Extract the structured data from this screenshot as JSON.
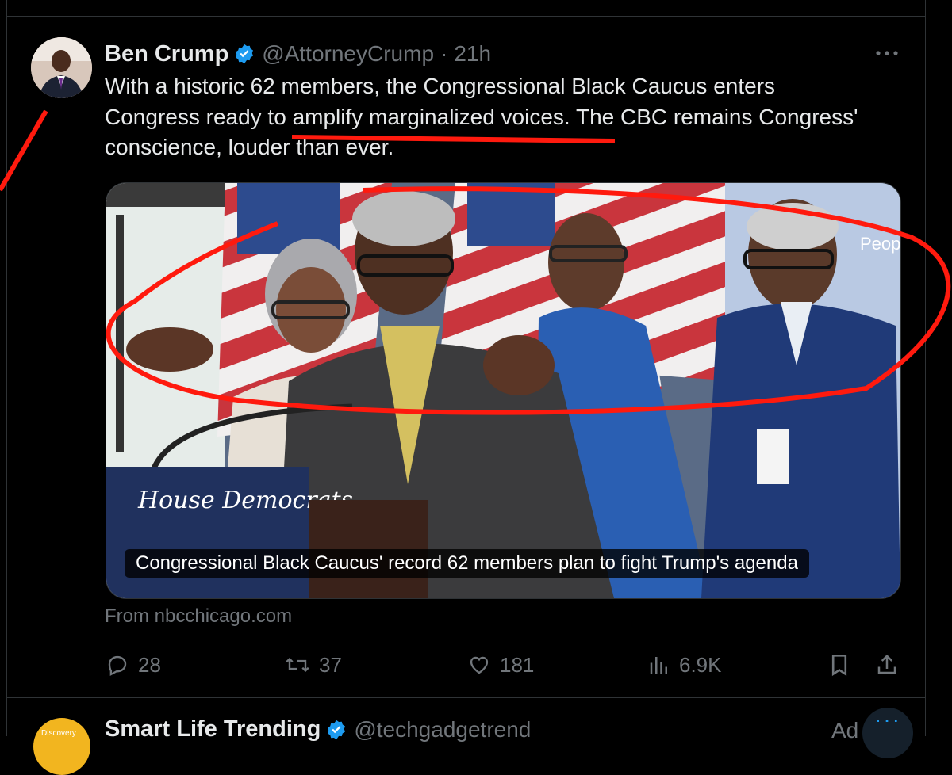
{
  "tweet": {
    "author_name": "Ben Crump",
    "handle": "@AttorneyCrump",
    "separator": "·",
    "time": "21h",
    "text_line1": "With a historic 62 members, the Congressional Black Caucus enters",
    "text_line2": "Congress ready to amplify marginalized voices. The CBC remains Congress'",
    "text_line3": "conscience, louder than ever.",
    "card": {
      "caption": "Congressional Black Caucus' record 62 members plan to fight Trump's agenda",
      "source": "From nbcchicago.com",
      "image_texts": [
        "House Democrats",
        "People"
      ]
    },
    "actions": {
      "replies": "28",
      "reposts": "37",
      "likes": "181",
      "views": "6.9K"
    }
  },
  "next_tweet": {
    "avatar_text": "Discovery",
    "author_name": "Smart Life Trending",
    "handle": "@techgadgetrend",
    "ad_label": "Ad"
  },
  "icons": [
    "verified-badge-icon",
    "more-icon",
    "reply-icon",
    "repost-icon",
    "like-icon",
    "views-icon",
    "bookmark-icon",
    "share-icon"
  ],
  "colors": {
    "background": "#000000",
    "text": "#e7e9ea",
    "muted": "#71767b",
    "verified": "#1d9bf0",
    "annotation": "#ff1a0e"
  }
}
